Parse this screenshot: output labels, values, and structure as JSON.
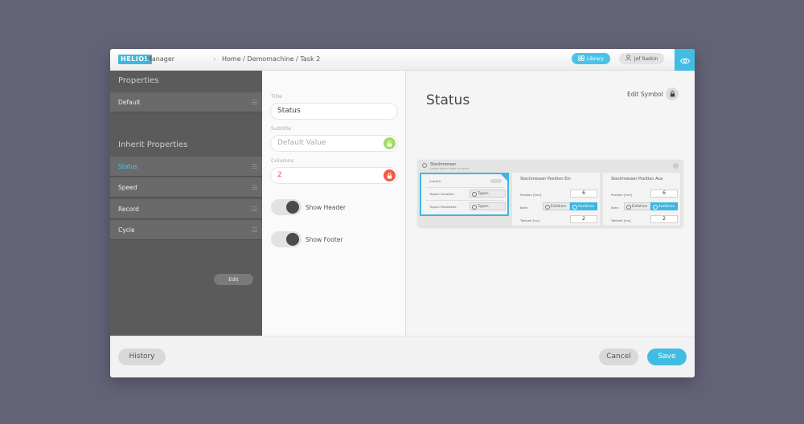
{
  "header": {
    "logo": "HELIOS",
    "app_name": "Manager",
    "breadcrumb": "Home / Demomachine / Task 2",
    "library_label": "Library",
    "user_name": "Jef Raskin",
    "accent": "#41bde3"
  },
  "sidebar": {
    "properties_heading": "Properties",
    "default_item": "Default",
    "inherit_heading": "Inherit Properties",
    "items": [
      {
        "label": "Status",
        "active": true
      },
      {
        "label": "Speed",
        "active": false
      },
      {
        "label": "Record",
        "active": false
      },
      {
        "label": "Cycle",
        "active": false
      }
    ],
    "edit_label": "Edit"
  },
  "form": {
    "title_label": "Title",
    "title_value": "Status",
    "subtitle_label": "Subtitle",
    "subtitle_value": "Default Value",
    "columns_label": "Columns",
    "columns_value": "2",
    "show_header_label": "Show Header",
    "show_footer_label": "Show Footer",
    "unlocked_color": "#a6d96a",
    "locked_color": "#ef5a47"
  },
  "main": {
    "title": "Status",
    "edit_symbol_label": "Edit Symbol"
  },
  "preview": {
    "title": "Stechmesser",
    "subtitle": "Lorem ipsum dolor sit amet",
    "card1": {
      "rows": [
        {
          "label": "Auto/Hr"
        },
        {
          "label": "Tippen Vorwärts",
          "button": "Tippen"
        },
        {
          "label": "Tippen Rückwärts",
          "button": "Tippen"
        }
      ]
    },
    "card2": {
      "heading": "Stechmesser Position Ein",
      "position_label": "Position [mm]",
      "position_value": "6",
      "buttons_label": "Bahn",
      "button_a": "Einfahren",
      "button_b": "Ausfahren",
      "takt_label": "Taktzeit [ms]",
      "takt_value": "2"
    },
    "card3": {
      "heading": "Stechmesser Position Aus",
      "position_label": "Position [mm]",
      "position_value": "6",
      "buttons_label": "Bahn",
      "button_a": "Einfahren",
      "button_b": "Ausfahren",
      "takt_label": "Taktzeit [ms]",
      "takt_value": "2"
    }
  },
  "footer": {
    "history_label": "History",
    "cancel_label": "Cancel",
    "save_label": "Save"
  }
}
